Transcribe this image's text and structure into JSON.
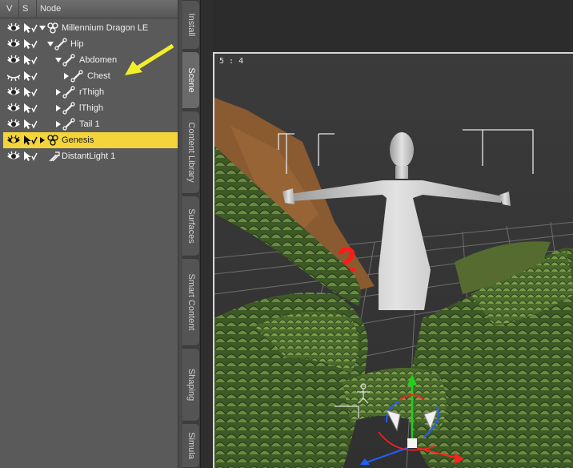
{
  "columns": {
    "v": "V",
    "s": "S",
    "node": "Node"
  },
  "tree": [
    {
      "label": "Millennium Dragon LE",
      "icon": "figure-icon",
      "expand": "down",
      "indent": 0,
      "eye": "open"
    },
    {
      "label": "Hip",
      "icon": "bone-icon",
      "expand": "down",
      "indent": 1,
      "eye": "open"
    },
    {
      "label": "Abdomen",
      "icon": "bone-icon",
      "expand": "down",
      "indent": 2,
      "eye": "open"
    },
    {
      "label": "Chest",
      "icon": "bone-icon",
      "expand": "right",
      "indent": 3,
      "eye": "closed"
    },
    {
      "label": "rThigh",
      "icon": "bone-icon",
      "expand": "right",
      "indent": 2,
      "eye": "open"
    },
    {
      "label": "lThigh",
      "icon": "bone-icon",
      "expand": "right",
      "indent": 2,
      "eye": "open"
    },
    {
      "label": "Tail 1",
      "icon": "bone-icon",
      "expand": "right",
      "indent": 2,
      "eye": "open"
    },
    {
      "label": "Genesis",
      "icon": "figure-icon",
      "expand": "right",
      "indent": 0,
      "eye": "open",
      "selected": true
    },
    {
      "label": "DistantLight 1",
      "icon": "light-icon",
      "expand": "none",
      "indent": 0,
      "eye": "open"
    }
  ],
  "tabs": [
    {
      "label": "Install",
      "active": false
    },
    {
      "label": "Scene",
      "active": true
    },
    {
      "label": "Content Library",
      "active": false
    },
    {
      "label": "Surfaces",
      "active": false
    },
    {
      "label": "Smart Content",
      "active": false
    },
    {
      "label": "Shaping",
      "active": false
    },
    {
      "label": "Simula",
      "active": false
    }
  ],
  "viewport": {
    "aspect_label": "5 : 4",
    "annotation_number": "2"
  },
  "colors": {
    "selection": "#f3d53b",
    "arrow": "#f2ee2a",
    "annotation": "#ff1a1a"
  }
}
